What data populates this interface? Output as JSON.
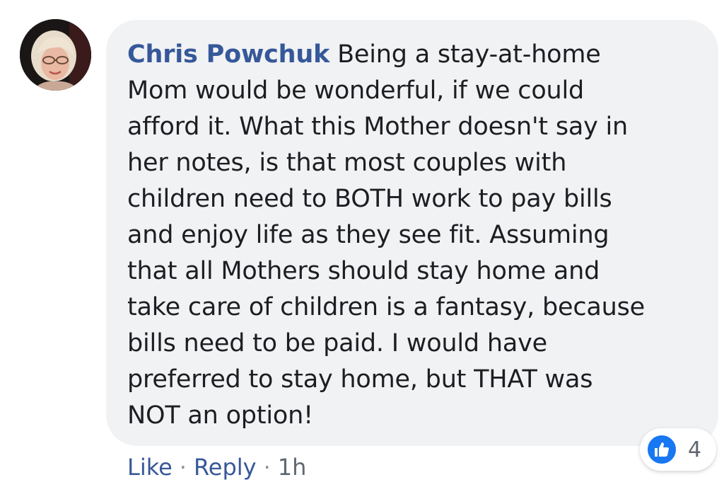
{
  "comment": {
    "author": "Chris Powchuk",
    "text": " Being a stay-at-home\nMom would be wonderful, if we could\nafford it. What this Mother doesn't say in\nher notes, is that most couples with\nchildren need to BOTH work to pay bills\nand enjoy life as they see fit. Assuming\nthat all Mothers should stay home and\ntake care of children is a fantasy, because\nbills need to be paid. I would have\npreferred to stay home, but THAT was\nNOT an option!"
  },
  "reactions": {
    "icon": "like-icon",
    "count": "4"
  },
  "actions": {
    "like_label": "Like",
    "separator": "·",
    "reply_label": "Reply",
    "time": "1h"
  },
  "colors": {
    "author": "#365899",
    "bubble": "#f1f2f4",
    "like_badge": "#1877f2"
  }
}
